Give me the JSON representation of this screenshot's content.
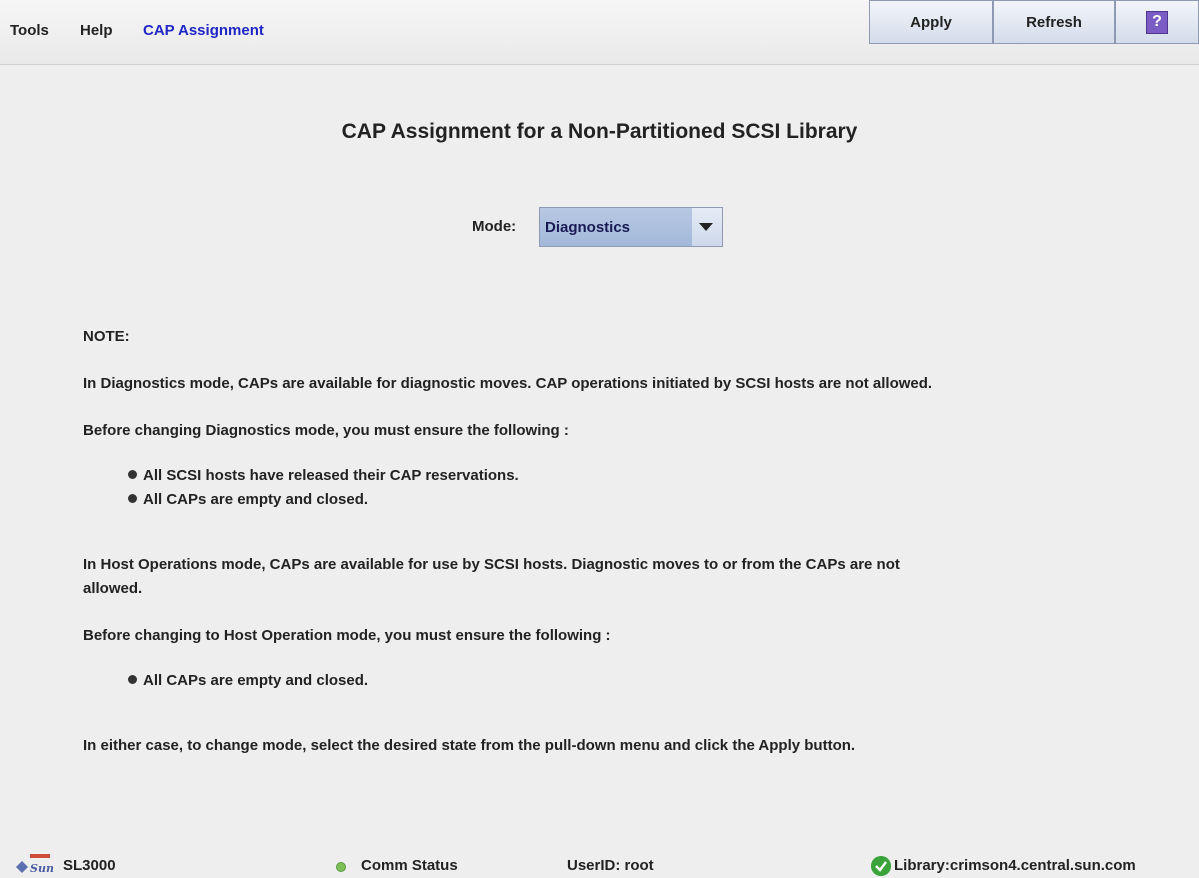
{
  "menu": {
    "tools": "Tools",
    "help": "Help",
    "active": "CAP Assignment"
  },
  "toolbar": {
    "apply_label": "Apply",
    "refresh_label": "Refresh",
    "help_glyph": "?"
  },
  "page": {
    "title": "CAP Assignment for a Non-Partitioned SCSI Library"
  },
  "mode": {
    "label": "Mode:",
    "value": "Diagnostics"
  },
  "note": {
    "heading": "NOTE:",
    "diag_desc": "In Diagnostics mode, CAPs are available for diagnostic moves. CAP operations initiated by SCSI hosts are not allowed.",
    "diag_before": "Before changing Diagnostics mode, you must ensure the following :",
    "diag_bullets": [
      "All SCSI hosts have released their CAP reservations.",
      "All CAPs are empty and closed."
    ],
    "host_desc_line1": "In Host Operations mode, CAPs are available for use by SCSI hosts. Diagnostic moves to or from the CAPs are not",
    "host_desc_line2": "allowed.",
    "host_before": "Before changing to Host Operation mode, you must ensure the following :",
    "host_bullets": [
      "All CAPs are empty and closed."
    ],
    "footer": "In either case, to change mode, select the desired state from the pull-down menu and click the Apply button."
  },
  "status": {
    "logo_text": "Sun",
    "product": "SL3000",
    "comm_status": "Comm Status",
    "user_id": "UserID: root",
    "library": "Library:crimson4.central.sun.com"
  },
  "colors": {
    "active_menu": "#1f26c6",
    "select_fill": "#a3b8da",
    "help_icon": "#7b5cc4",
    "ok_green": "#3aa43a"
  }
}
